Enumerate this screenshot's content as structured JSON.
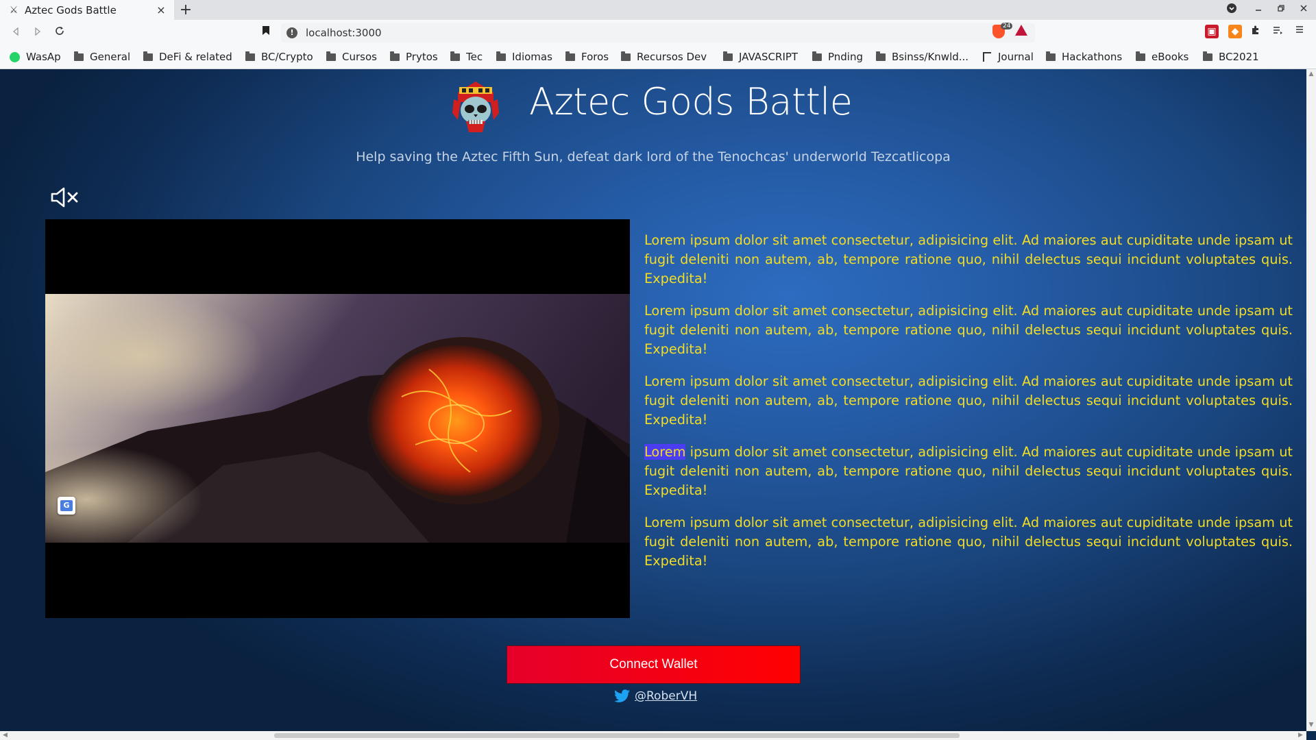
{
  "browser": {
    "tab_title": "Aztec Gods Battle",
    "tab_close": "×",
    "new_tab": "+",
    "url": "localhost:3000",
    "shield_count": "24",
    "bookmarks": [
      {
        "label": "WasAp",
        "type": "whatsapp"
      },
      {
        "label": "General",
        "type": "folder"
      },
      {
        "label": "DeFi & related",
        "type": "folder"
      },
      {
        "label": "BC/Crypto",
        "type": "folder"
      },
      {
        "label": "Cursos",
        "type": "folder"
      },
      {
        "label": "Prytos",
        "type": "folder"
      },
      {
        "label": "Tec",
        "type": "folder"
      },
      {
        "label": "Idiomas",
        "type": "folder"
      },
      {
        "label": "Foros",
        "type": "folder"
      },
      {
        "label": "Recursos Dev",
        "type": "folder"
      },
      {
        "label": "JAVASCRIPT",
        "type": "folder"
      },
      {
        "label": "Pnding",
        "type": "folder"
      },
      {
        "label": "Bsinss/Knwld...",
        "type": "folder"
      },
      {
        "label": "Journal",
        "type": "journal"
      },
      {
        "label": "Hackathons",
        "type": "folder"
      },
      {
        "label": "eBooks",
        "type": "folder"
      },
      {
        "label": "BC2021",
        "type": "folder"
      }
    ]
  },
  "page": {
    "title": "Aztec Gods Battle",
    "subtitle": "Help saving the Aztec Fifth Sun, defeat dark lord of the Tenochcas' underworld Tezcatlicopa",
    "mute_icon": "speaker-muted-icon",
    "paragraph_text": "ipsum dolor sit amet consectetur, adipisicing elit. Ad maiores aut cupiditate unde ipsam ut fugit deleniti non autem, ab, tempore ratione quo, nihil delectus sequi incidunt voluptates quis. Expedita!",
    "paragraphs": [
      {
        "first_word": "Lorem",
        "highlighted": false
      },
      {
        "first_word": "Lorem",
        "highlighted": false
      },
      {
        "first_word": "Lorem",
        "highlighted": false
      },
      {
        "first_word": "Lorem",
        "highlighted": true
      },
      {
        "first_word": "Lorem",
        "highlighted": false
      }
    ],
    "connect_button": "Connect Wallet",
    "twitter_handle": "@RoberVH"
  },
  "colors": {
    "paragraph_text": "#f3dd24",
    "connect_button": "#ff0000",
    "highlight": "#4a3df2"
  }
}
